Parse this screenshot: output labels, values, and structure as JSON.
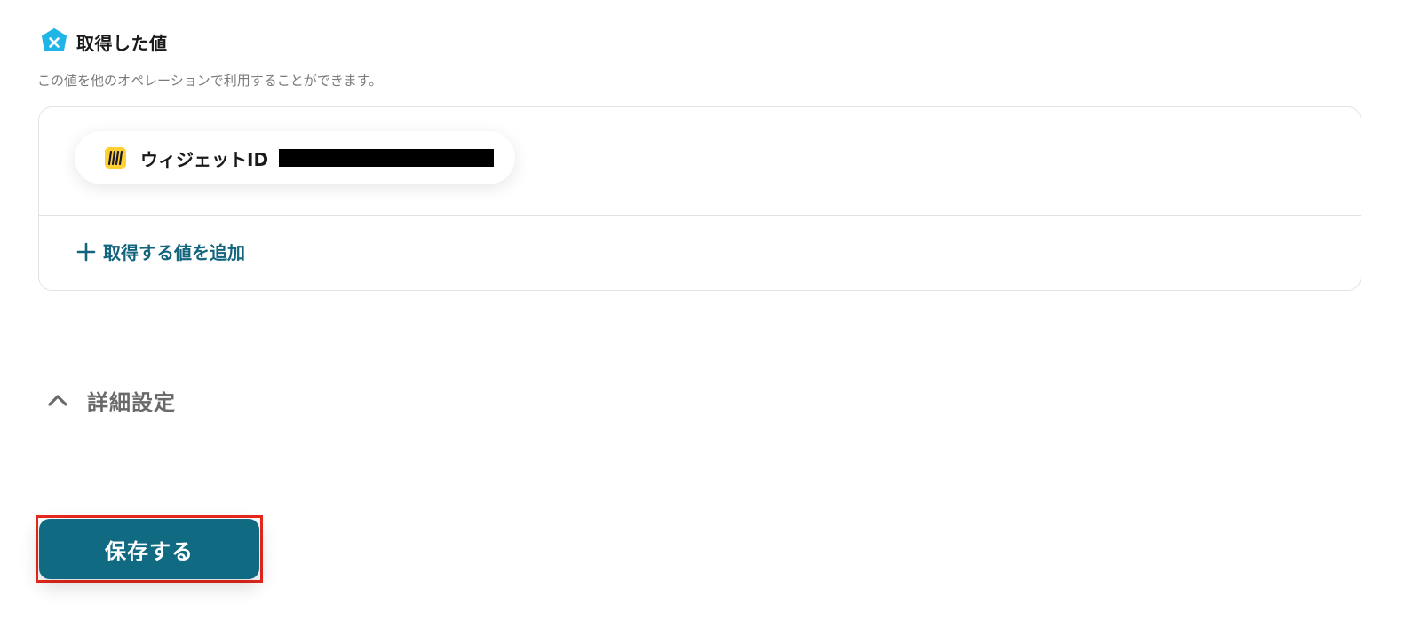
{
  "section": {
    "title": "取得した値",
    "description": "この値を他のオペレーションで利用することができます。",
    "icon": "variable-x-icon",
    "icon_color": "#1fb5e6"
  },
  "values": {
    "items": [
      {
        "label": "ウィジェットID",
        "icon": "miro-icon",
        "value_redacted": true
      }
    ],
    "add_label": "取得する値を追加",
    "add_icon": "plus-icon"
  },
  "advanced_settings": {
    "label": "詳細設定",
    "icon": "chevron-up-icon",
    "expanded": true
  },
  "footer": {
    "save_label": "保存する",
    "save_color": "#106a82",
    "highlight_color": "#e8281d"
  }
}
